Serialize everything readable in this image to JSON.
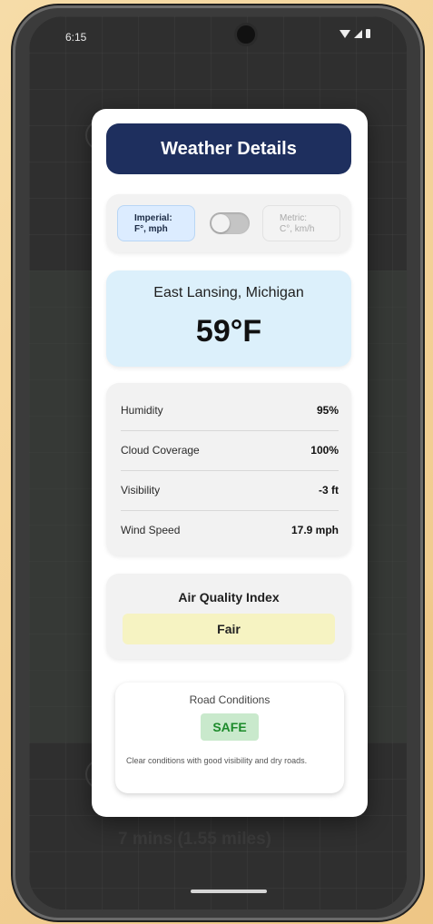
{
  "status_bar": {
    "time": "6:15"
  },
  "modal": {
    "title": "Weather Details",
    "units": {
      "imperial_line1": "Imperial:",
      "imperial_line2": "F°, mph",
      "metric_line1": "Metric:",
      "metric_line2": "C°, km/h",
      "selected": "imperial"
    },
    "location": {
      "name": "East Lansing, Michigan",
      "temperature": "59°F"
    },
    "stats": [
      {
        "label": "Humidity",
        "value": "95%"
      },
      {
        "label": "Cloud Coverage",
        "value": "100%"
      },
      {
        "label": "Visibility",
        "value": "-3 ft"
      },
      {
        "label": "Wind Speed",
        "value": "17.9 mph"
      }
    ],
    "air_quality": {
      "title": "Air Quality Index",
      "value": "Fair"
    },
    "road": {
      "title": "Road Conditions",
      "status": "SAFE",
      "description": "Clear conditions with good visibility and dry roads."
    }
  },
  "background": {
    "eta": "7 mins (1.55 miles)"
  },
  "colors": {
    "title_bar": "#1e2f5e",
    "location_card": "#dcf0fb",
    "aqi_badge": "#f6f3c2",
    "safe_badge_bg": "#c9e9cc",
    "safe_text": "#1c8a2a"
  }
}
